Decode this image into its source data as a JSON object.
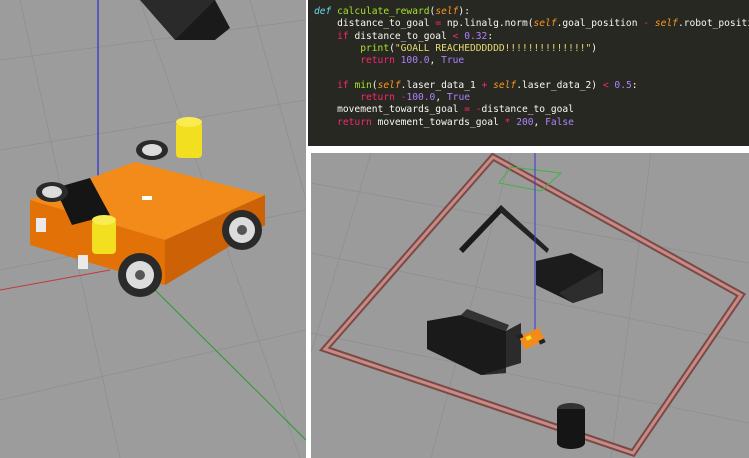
{
  "code": {
    "lines": [
      [
        {
          "t": "def",
          "c": "def"
        },
        {
          "t": " "
        },
        {
          "t": "calculate_reward",
          "c": "fn"
        },
        {
          "t": "("
        },
        {
          "t": "self",
          "c": "self"
        },
        {
          "t": "):"
        }
      ],
      [
        {
          "t": "    "
        },
        {
          "t": "distance_to_goal "
        },
        {
          "t": "=",
          "c": "op"
        },
        {
          "t": " np.linalg.norm("
        },
        {
          "t": "self",
          "c": "self"
        },
        {
          "t": ".goal_position "
        },
        {
          "t": "-",
          "c": "op"
        },
        {
          "t": " "
        },
        {
          "t": "self",
          "c": "self"
        },
        {
          "t": ".robot_position"
        }
      ],
      [
        {
          "t": "    "
        },
        {
          "t": "if",
          "c": "kw"
        },
        {
          "t": " distance_to_goal "
        },
        {
          "t": "<",
          "c": "op"
        },
        {
          "t": " "
        },
        {
          "t": "0.32",
          "c": "num"
        },
        {
          "t": ":"
        }
      ],
      [
        {
          "t": "        "
        },
        {
          "t": "print",
          "c": "fn"
        },
        {
          "t": "("
        },
        {
          "t": "\"GOALL REACHEDDDDDD!!!!!!!!!!!!!!\"",
          "c": "str"
        },
        {
          "t": ")"
        }
      ],
      [
        {
          "t": "        "
        },
        {
          "t": "return",
          "c": "kw"
        },
        {
          "t": " "
        },
        {
          "t": "100.0",
          "c": "num"
        },
        {
          "t": ", "
        },
        {
          "t": "True",
          "c": "bool"
        }
      ],
      [
        {
          "t": ""
        }
      ],
      [
        {
          "t": "    "
        },
        {
          "t": "if",
          "c": "kw"
        },
        {
          "t": " "
        },
        {
          "t": "min",
          "c": "fn"
        },
        {
          "t": "("
        },
        {
          "t": "self",
          "c": "self"
        },
        {
          "t": ".laser_data_1 "
        },
        {
          "t": "+",
          "c": "op"
        },
        {
          "t": " "
        },
        {
          "t": "self",
          "c": "self"
        },
        {
          "t": ".laser_data_2) "
        },
        {
          "t": "<",
          "c": "op"
        },
        {
          "t": " "
        },
        {
          "t": "0.5",
          "c": "num"
        },
        {
          "t": ":"
        }
      ],
      [
        {
          "t": "        "
        },
        {
          "t": "return",
          "c": "kw"
        },
        {
          "t": " "
        },
        {
          "t": "-",
          "c": "op"
        },
        {
          "t": "100.0",
          "c": "num"
        },
        {
          "t": ", "
        },
        {
          "t": "True",
          "c": "bool"
        }
      ],
      [
        {
          "t": "    "
        },
        {
          "t": "movement_towards_goal "
        },
        {
          "t": "=",
          "c": "op"
        },
        {
          "t": " "
        },
        {
          "t": "-",
          "c": "op"
        },
        {
          "t": "distance_to_goal"
        }
      ],
      [
        {
          "t": "    "
        },
        {
          "t": "return",
          "c": "kw"
        },
        {
          "t": " movement_towards_goal "
        },
        {
          "t": "*",
          "c": "op"
        },
        {
          "t": " "
        },
        {
          "t": "200",
          "c": "num"
        },
        {
          "t": ", "
        },
        {
          "t": "False",
          "c": "bool"
        }
      ]
    ]
  },
  "colors": {
    "ground": "#9c9c9c",
    "robot_body": "#f0830e",
    "sensor": "#f2e020",
    "wall_frame": "#9a5a55",
    "obstacle": "#1c1c1c",
    "code_bg": "#272822"
  }
}
